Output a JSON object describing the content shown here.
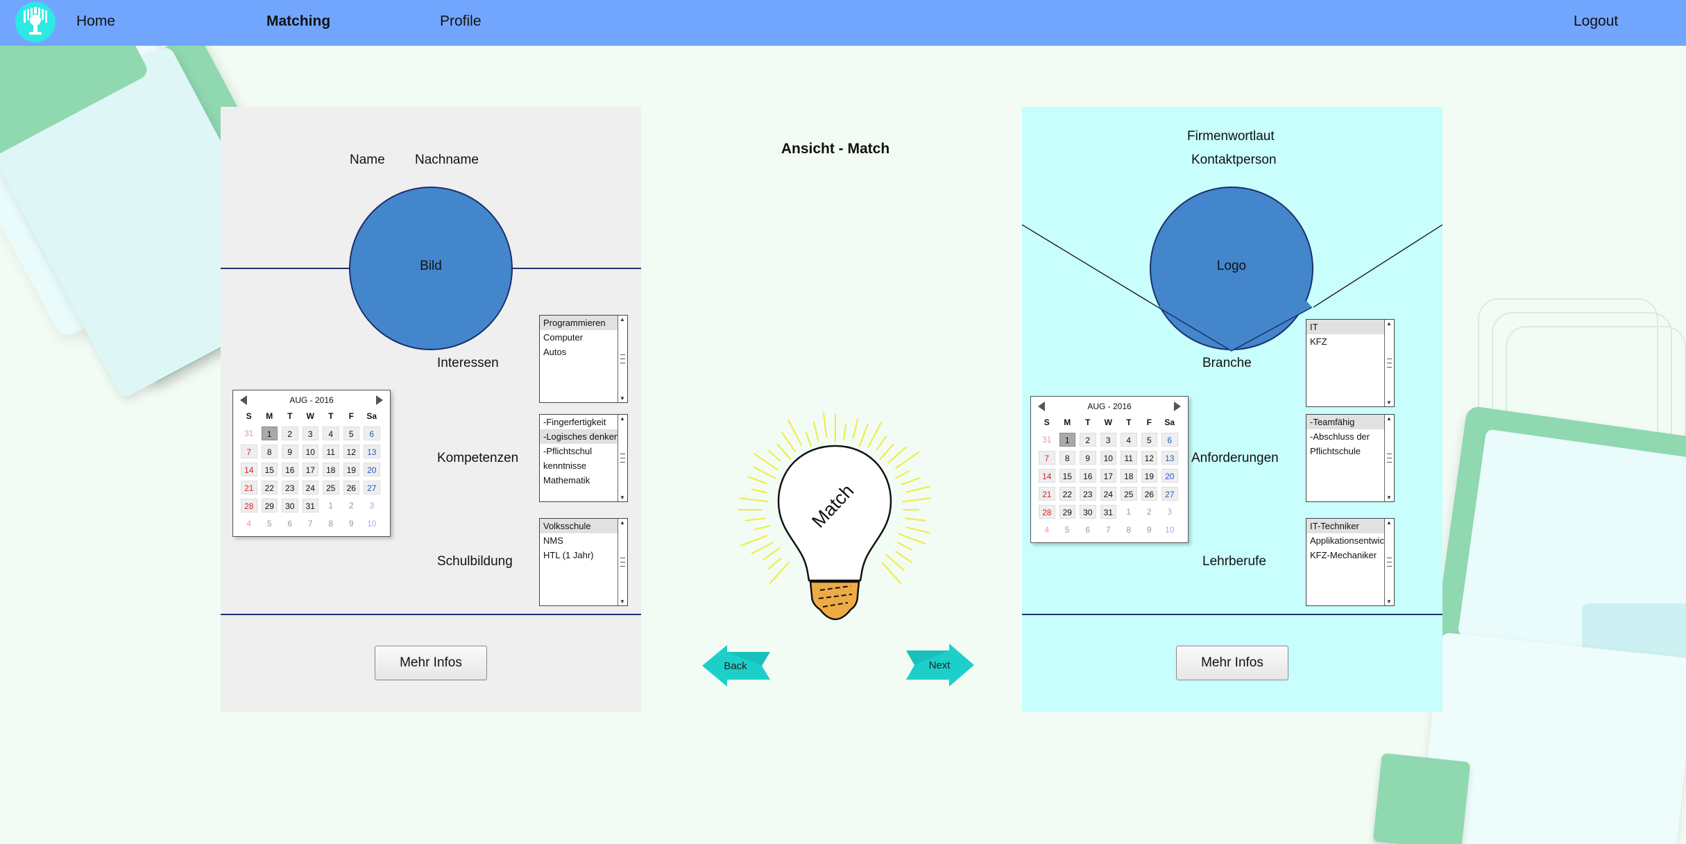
{
  "nav": {
    "home": "Home",
    "matching": "Matching",
    "profile": "Profile",
    "logout": "Logout"
  },
  "center": {
    "title": "Ansicht - Match",
    "match_label": "Match",
    "back": "Back",
    "next": "Next"
  },
  "student": {
    "name": "Name",
    "surname": "Nachname",
    "image_label": "Bild",
    "interests_label": "Interessen",
    "interests": [
      "Programmieren",
      "Computer",
      "Autos"
    ],
    "skills_label": "Kompetenzen",
    "skills": [
      "-Fingerfertigkeit",
      "-Logisches denken",
      "-Pflichtschul",
      "kenntnisse",
      "Mathematik"
    ],
    "education_label": "Schulbildung",
    "education": [
      "Volksschule",
      "NMS",
      "HTL (1 Jahr)"
    ],
    "more_info": "Mehr Infos"
  },
  "company": {
    "name": "Firmenwortlaut",
    "contact": "Kontaktperson",
    "logo_label": "Logo",
    "branch_label": "Branche",
    "branches": [
      "IT",
      "KFZ"
    ],
    "requirements_label": "Anforderungen",
    "requirements": [
      "-Teamfähig",
      "-Abschluss der",
      "Pflichtschule"
    ],
    "apprenticeships_label": "Lehrberufe",
    "apprenticeships": [
      "IT-Techniker",
      "Applikationsentwic",
      "KFZ-Mechaniker"
    ],
    "more_info": "Mehr Infos"
  },
  "calendar": {
    "month_label": "AUG - 2016",
    "weekdays": [
      "S",
      "M",
      "T",
      "W",
      "T",
      "F",
      "Sa"
    ],
    "weeks": [
      [
        "31",
        "1",
        "2",
        "3",
        "4",
        "5",
        "6"
      ],
      [
        "7",
        "8",
        "9",
        "10",
        "11",
        "12",
        "13"
      ],
      [
        "14",
        "15",
        "16",
        "17",
        "18",
        "19",
        "20"
      ],
      [
        "21",
        "22",
        "23",
        "24",
        "25",
        "26",
        "27"
      ],
      [
        "28",
        "29",
        "30",
        "31",
        "1",
        "2",
        "3"
      ],
      [
        "4",
        "5",
        "6",
        "7",
        "8",
        "9",
        "10"
      ]
    ],
    "selected_day": "1"
  },
  "colors": {
    "nav_bg": "#72a6fe",
    "page_bg": "#f2fcf4",
    "student_panel": "#efefef",
    "company_panel": "#c8fefc",
    "avatar_fill": "#4386cc",
    "arrow": "#1dcfcb",
    "deco_green": "#8fd8b0"
  }
}
